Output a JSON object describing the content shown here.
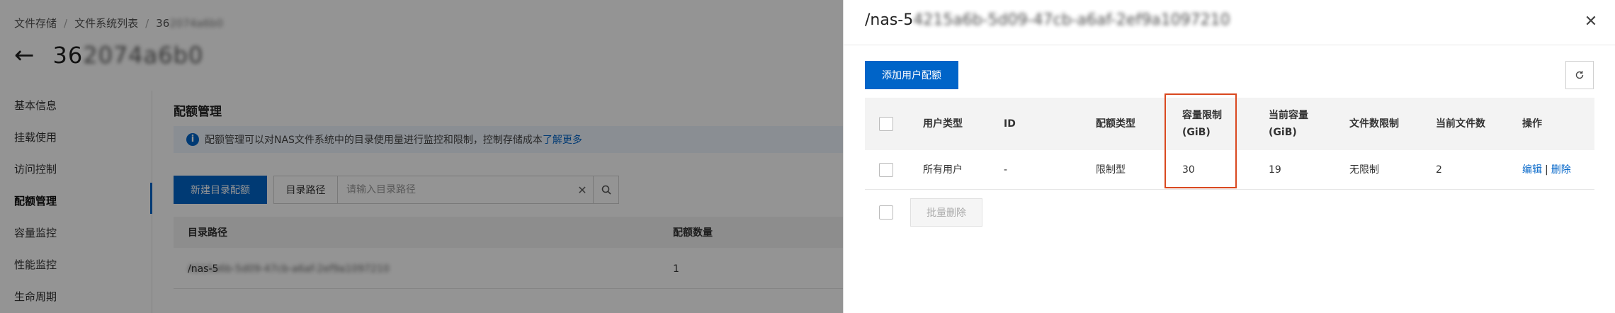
{
  "background": {
    "breadcrumb": [
      "文件存储",
      "文件系统列表",
      "36"
    ],
    "breadcrumb_blurred_suffix": "2074a6b0",
    "page_title": "36",
    "page_title_blurred_suffix": "2074a6b0",
    "sidebar": {
      "items": [
        {
          "label": "基本信息"
        },
        {
          "label": "挂载使用"
        },
        {
          "label": "访问控制"
        },
        {
          "label": "配额管理",
          "active": true
        },
        {
          "label": "容量监控"
        },
        {
          "label": "性能监控"
        },
        {
          "label": "生命周期"
        }
      ]
    },
    "section_title": "配额管理",
    "notice": {
      "text": "配额管理可以对NAS文件系统中的目录使用量进行监控和限制，控制存储成本",
      "link": "了解更多"
    },
    "new_dir_quota_button": "新建目录配额",
    "search": {
      "label": "目录路径",
      "placeholder": "请输入目录路径"
    },
    "table": {
      "headers": [
        "目录路径",
        "配额数量"
      ],
      "rows": [
        {
          "path_prefix": "/nas-5",
          "path_blurred": "4215a6b-5d09-47cb-a6af-2ef9a1097210",
          "count": "1"
        }
      ]
    }
  },
  "drawer": {
    "title_prefix": "/nas-5",
    "title_blurred": "4215a6b-5d09-47cb-a6af-2ef9a1097210",
    "add_user_quota_button": "添加用户配额",
    "table": {
      "headers": {
        "user_type": "用户类型",
        "id": "ID",
        "quota_type": "配额类型",
        "capacity_limit_1": "容量限制",
        "capacity_limit_2": "(GiB)",
        "current_capacity_1": "当前容量",
        "current_capacity_2": "(GiB)",
        "file_limit": "文件数限制",
        "current_files": "当前文件数",
        "actions": "操作"
      },
      "rows": [
        {
          "user_type": "所有用户",
          "id": "-",
          "quota_type": "限制型",
          "capacity_limit": "30",
          "current_capacity": "19",
          "file_limit": "无限制",
          "current_files": "2",
          "edit": "编辑",
          "separator": "|",
          "delete": "删除"
        }
      ]
    },
    "batch_delete_button": "批量删除"
  },
  "colors": {
    "primary": "#0064c8",
    "highlight": "#d9481f",
    "overlay": "rgba(0,0,0,0.42)"
  }
}
